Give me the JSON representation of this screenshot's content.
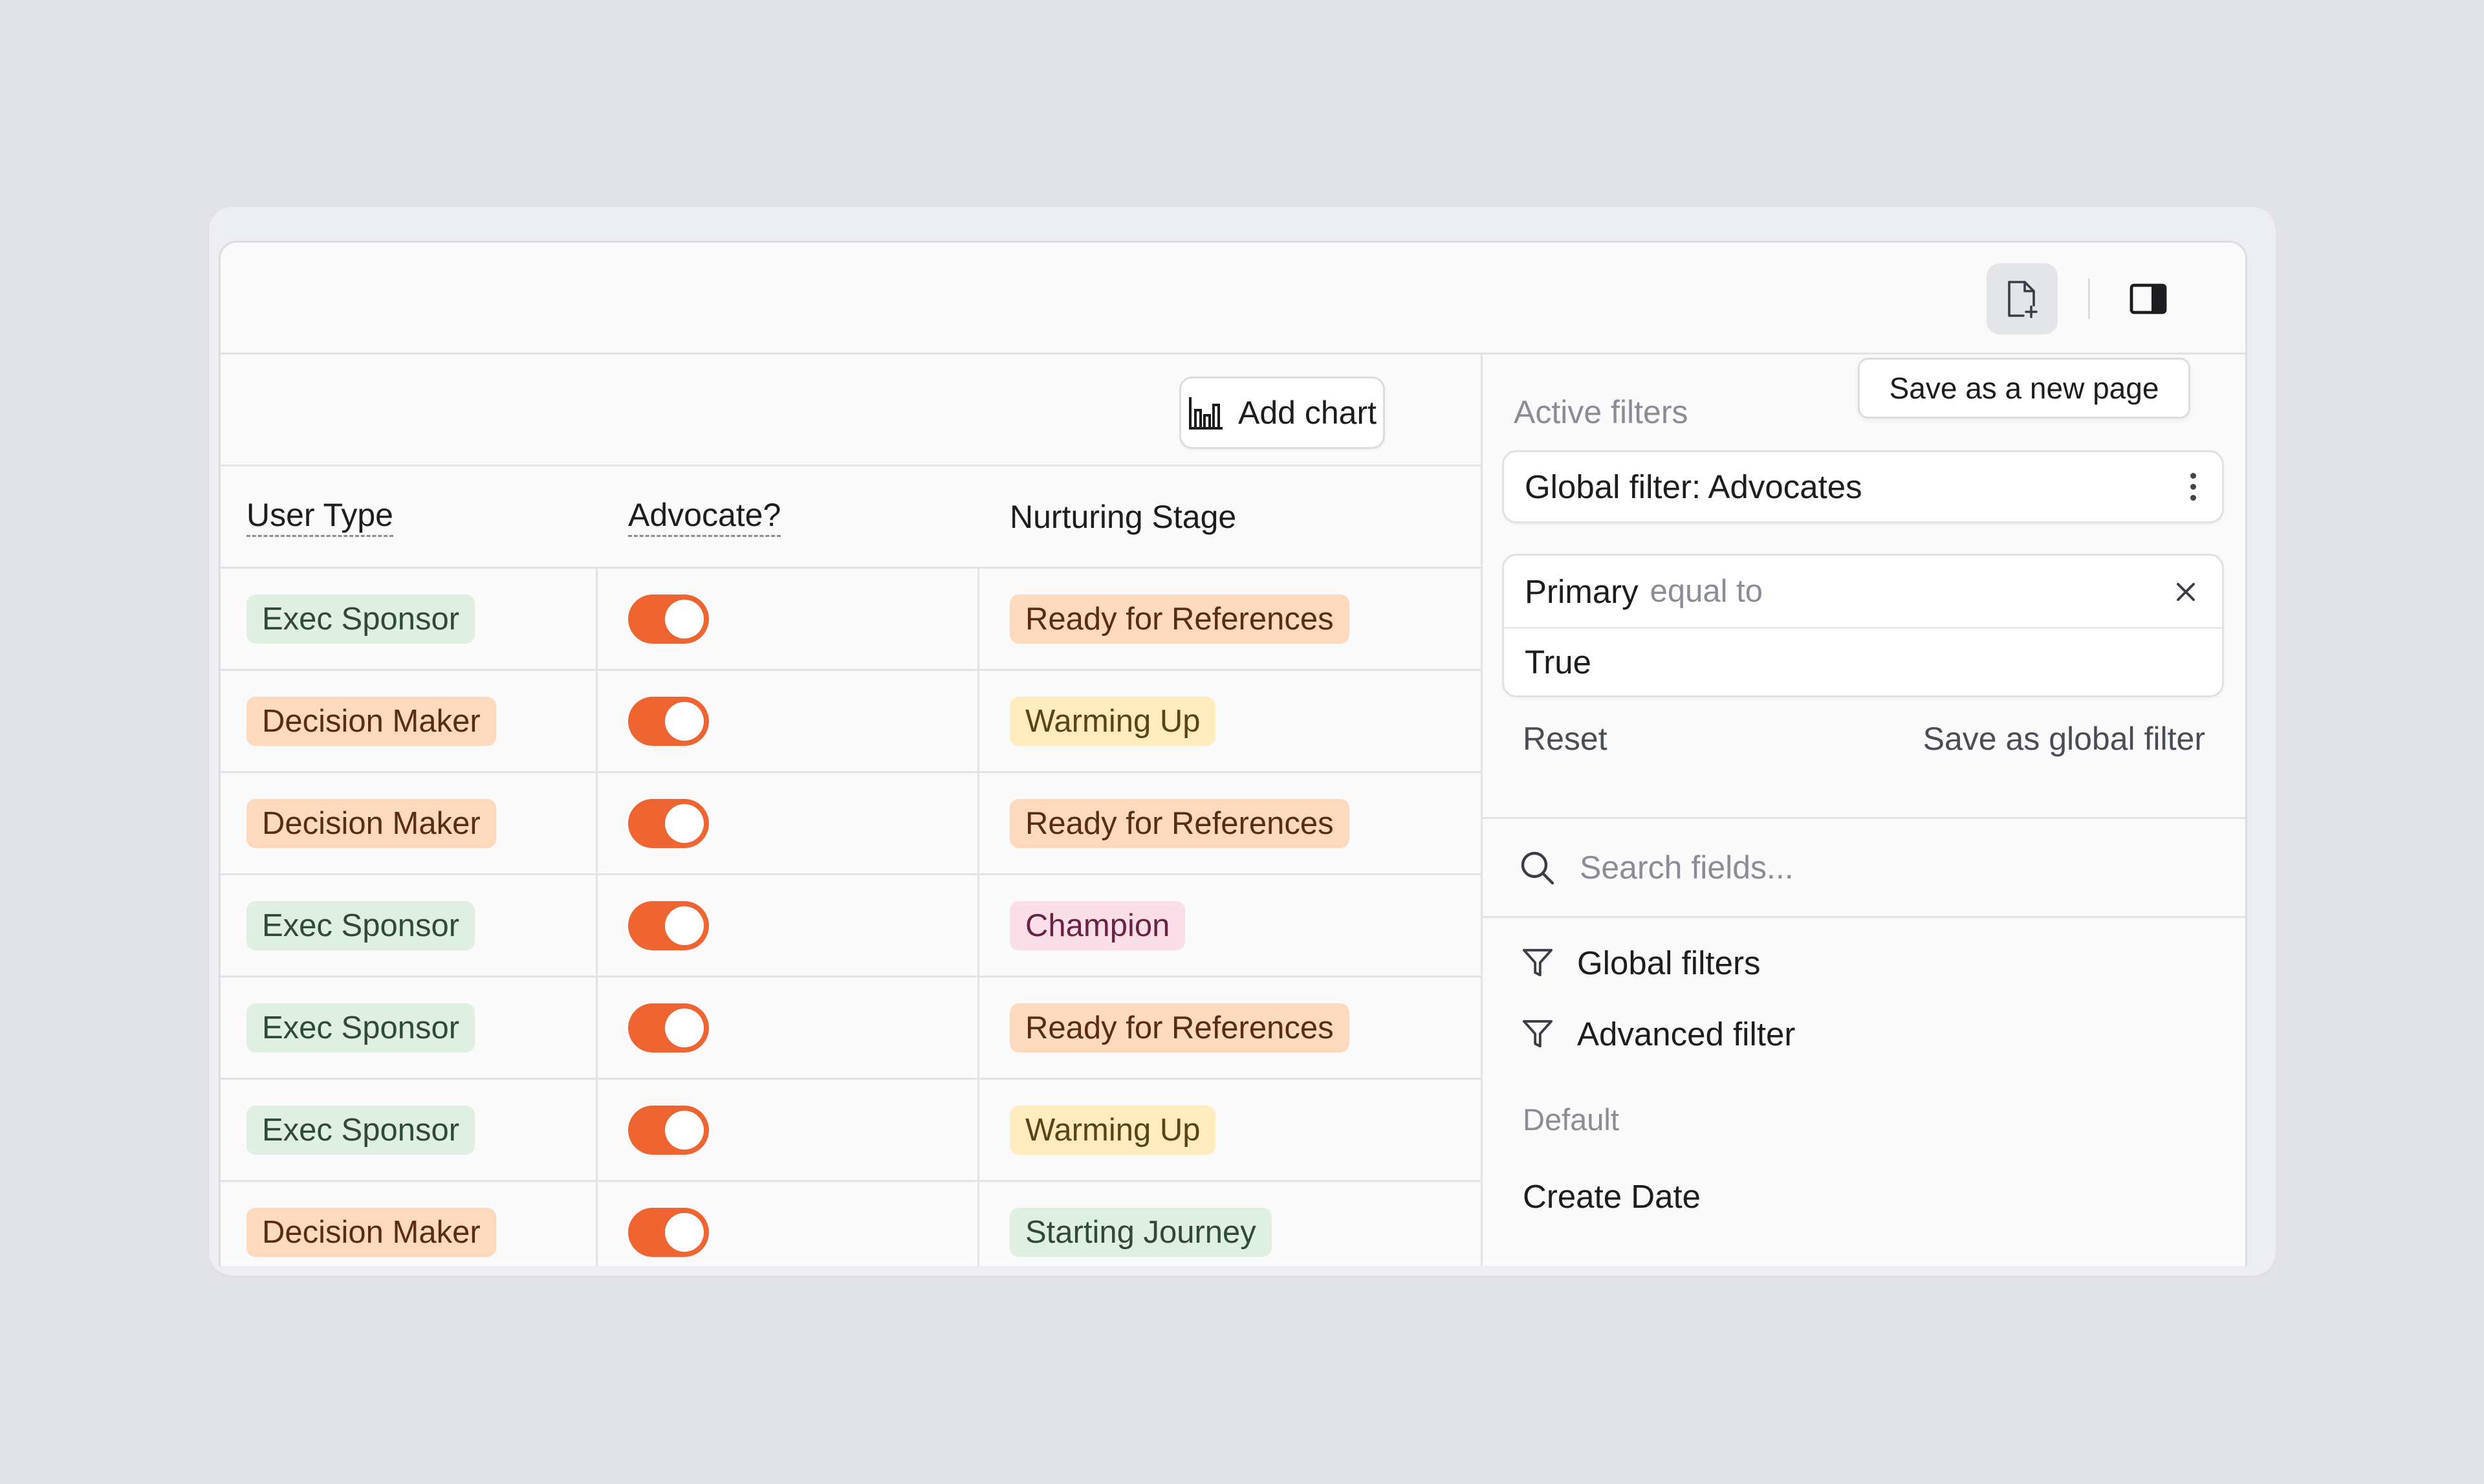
{
  "toolbar": {
    "new_page_icon": "file-plus-icon",
    "panel_icon": "sidebar-right-icon"
  },
  "main": {
    "add_chart_label": "Add chart",
    "columns": [
      "User Type",
      "Advocate?",
      "Nurturing Stage"
    ],
    "rows": [
      {
        "user_type": "Exec Sponsor",
        "user_type_color": "green",
        "advocate": true,
        "stage": "Ready for References",
        "stage_color": "orange"
      },
      {
        "user_type": "Decision Maker",
        "user_type_color": "orange",
        "advocate": true,
        "stage": "Warming Up",
        "stage_color": "yellow"
      },
      {
        "user_type": "Decision Maker",
        "user_type_color": "orange",
        "advocate": true,
        "stage": "Ready for References",
        "stage_color": "orange"
      },
      {
        "user_type": "Exec Sponsor",
        "user_type_color": "green",
        "advocate": true,
        "stage": "Champion",
        "stage_color": "pink"
      },
      {
        "user_type": "Exec Sponsor",
        "user_type_color": "green",
        "advocate": true,
        "stage": "Ready for References",
        "stage_color": "orange"
      },
      {
        "user_type": "Exec Sponsor",
        "user_type_color": "green",
        "advocate": true,
        "stage": "Warming Up",
        "stage_color": "yellow"
      },
      {
        "user_type": "Decision Maker",
        "user_type_color": "orange",
        "advocate": true,
        "stage": "Starting Journey",
        "stage_color": "green"
      }
    ]
  },
  "filters": {
    "title": "Active filters",
    "tooltip": "Save as a new page",
    "global_filter_label": "Global filter: Advocates",
    "condition": {
      "field": "Primary",
      "operator": "equal to",
      "value": "True"
    },
    "reset_label": "Reset",
    "save_global_label": "Save as global filter",
    "search_placeholder": "Search fields...",
    "menu": [
      "Global filters",
      "Advanced filter"
    ],
    "section_default": "Default",
    "fields": [
      "Create Date"
    ]
  },
  "colors": {
    "accent": "#ef6532",
    "tag_green_bg": "#dff0e3",
    "tag_orange_bg": "#fdd9bd",
    "tag_yellow_bg": "#feecbf",
    "tag_pink_bg": "#fbdfe8"
  }
}
